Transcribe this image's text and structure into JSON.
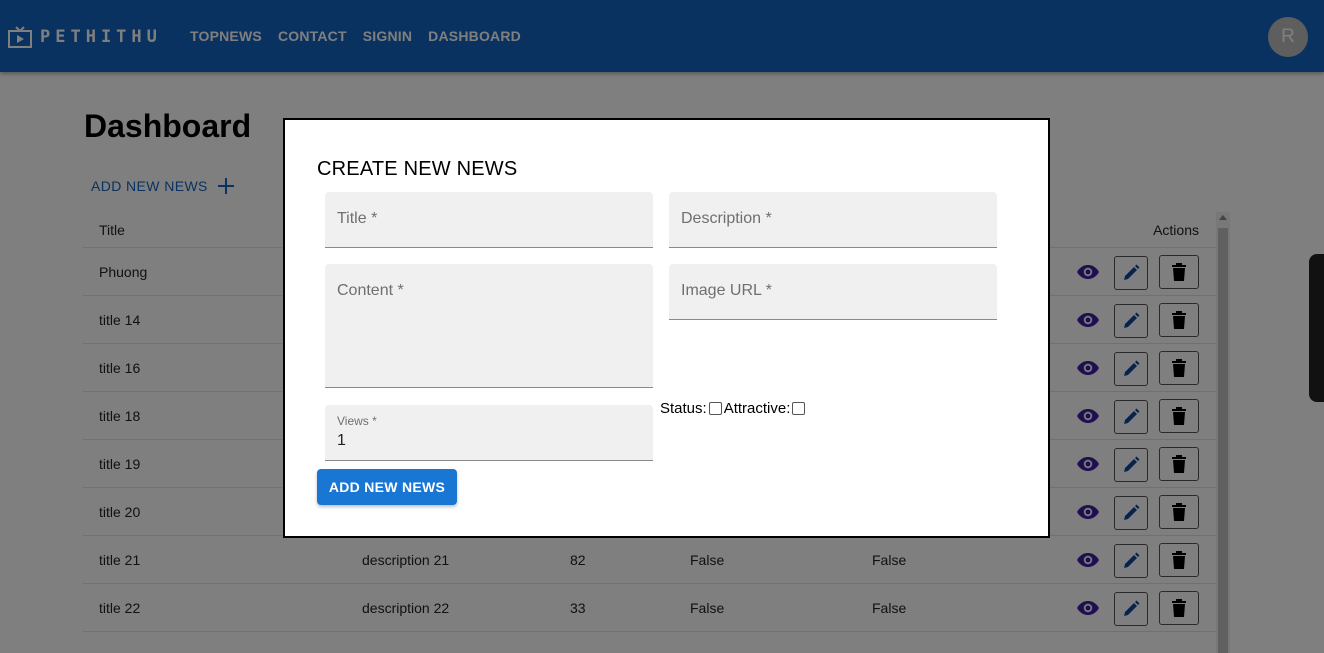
{
  "brand": {
    "name": "PETHITHU",
    "icon": "tv-icon"
  },
  "nav": [
    {
      "label": "TOPNEWS"
    },
    {
      "label": "CONTACT"
    },
    {
      "label": "SIGNIN"
    },
    {
      "label": "DASHBOARD"
    }
  ],
  "user": {
    "avatar_letter": "R"
  },
  "page": {
    "title": "Dashboard",
    "add_label": "ADD NEW NEWS"
  },
  "table": {
    "headers": {
      "title": "Title",
      "actions": "Actions"
    },
    "rows": [
      {
        "title": "Phuong",
        "description": "",
        "views": "",
        "status": "",
        "attractive": ""
      },
      {
        "title": "title 14",
        "description": "",
        "views": "",
        "status": "",
        "attractive": ""
      },
      {
        "title": "title 16",
        "description": "",
        "views": "",
        "status": "",
        "attractive": ""
      },
      {
        "title": "title 18",
        "description": "",
        "views": "",
        "status": "",
        "attractive": ""
      },
      {
        "title": "title 19",
        "description": "",
        "views": "",
        "status": "",
        "attractive": ""
      },
      {
        "title": "title 20",
        "description": "",
        "views": "",
        "status": "",
        "attractive": ""
      },
      {
        "title": "title 21",
        "description": "description 21",
        "views": "82",
        "status": "False",
        "attractive": "False"
      },
      {
        "title": "title 22",
        "description": "description 22",
        "views": "33",
        "status": "False",
        "attractive": "False"
      }
    ]
  },
  "modal": {
    "title": "CREATE NEW NEWS",
    "fields": {
      "title": "Title *",
      "description": "Description *",
      "content": "Content *",
      "image_url": "Image URL *",
      "views_label": "Views *",
      "views_value": "1"
    },
    "status_label": "Status:",
    "attractive_label": "Attractive:",
    "submit_label": "ADD NEW NEWS"
  },
  "colors": {
    "appbar": "#1565c0",
    "primary_button": "#1976d2",
    "eye_icon": "#3f1ea0"
  }
}
